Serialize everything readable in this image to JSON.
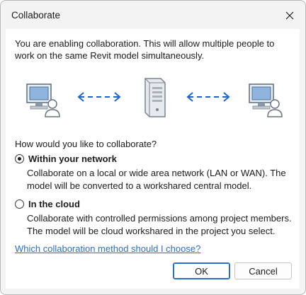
{
  "window": {
    "title": "Collaborate"
  },
  "intro": {
    "text": "You are enabling collaboration. This will allow multiple people to work on the same Revit model simultaneously."
  },
  "question": "How would you like to collaborate?",
  "options": [
    {
      "label": "Within your network",
      "description": "Collaborate on a local or wide area network (LAN or WAN). The model will be converted to a workshared central model.",
      "selected": true
    },
    {
      "label": "In the cloud",
      "description": "Collaborate with controlled permissions among project members. The model will be cloud workshared in the project you select.",
      "selected": false
    }
  ],
  "help_link": "Which collaboration method should I choose?",
  "buttons": {
    "ok": "OK",
    "cancel": "Cancel"
  },
  "colors": {
    "accent": "#2a6ed0",
    "arrow": "#1e64c8"
  },
  "icons": [
    "close-icon",
    "computer-user-icon",
    "server-icon",
    "double-arrow-icon"
  ]
}
